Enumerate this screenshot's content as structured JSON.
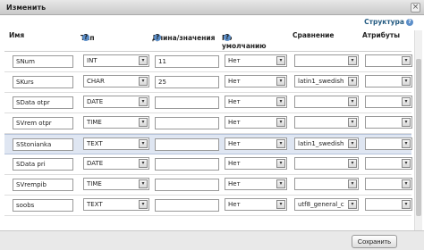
{
  "window": {
    "title": "Изменить",
    "close": "×"
  },
  "structure_link": "Структура",
  "headers": {
    "name": "Имя",
    "type": "Тип",
    "length": "Длина/значения",
    "default": "По умолчанию",
    "collation": "Сравнение",
    "attributes": "Атрибуты"
  },
  "rows": [
    {
      "name": "SNum",
      "type": "INT",
      "length": "11",
      "default": "Нет",
      "collation": "",
      "attributes": "",
      "highlight": false
    },
    {
      "name": "SKurs",
      "type": "CHAR",
      "length": "25",
      "default": "Нет",
      "collation": "latin1_swedish",
      "attributes": "",
      "highlight": false
    },
    {
      "name": "SData otpr",
      "type": "DATE",
      "length": "",
      "default": "Нет",
      "collation": "",
      "attributes": "",
      "highlight": false
    },
    {
      "name": "SVrem otpr",
      "type": "TIME",
      "length": "",
      "default": "Нет",
      "collation": "",
      "attributes": "",
      "highlight": false
    },
    {
      "name": "SStonianka",
      "type": "TEXT",
      "length": "",
      "default": "Нет",
      "collation": "latin1_swedish",
      "attributes": "",
      "highlight": true
    },
    {
      "name": "SData pri",
      "type": "DATE",
      "length": "",
      "default": "Нет",
      "collation": "",
      "attributes": "",
      "highlight": false
    },
    {
      "name": "SVrempib",
      "type": "TIME",
      "length": "",
      "default": "Нет",
      "collation": "",
      "attributes": "",
      "highlight": false
    },
    {
      "name": "soobs",
      "type": "TEXT",
      "length": "",
      "default": "Нет",
      "collation": "utf8_general_c",
      "attributes": "",
      "highlight": false
    }
  ],
  "footer": {
    "save_label": "Сохранить"
  },
  "colors": {
    "highlight_row": "#dfe6f2",
    "help_icon": "#5b8ec9"
  }
}
